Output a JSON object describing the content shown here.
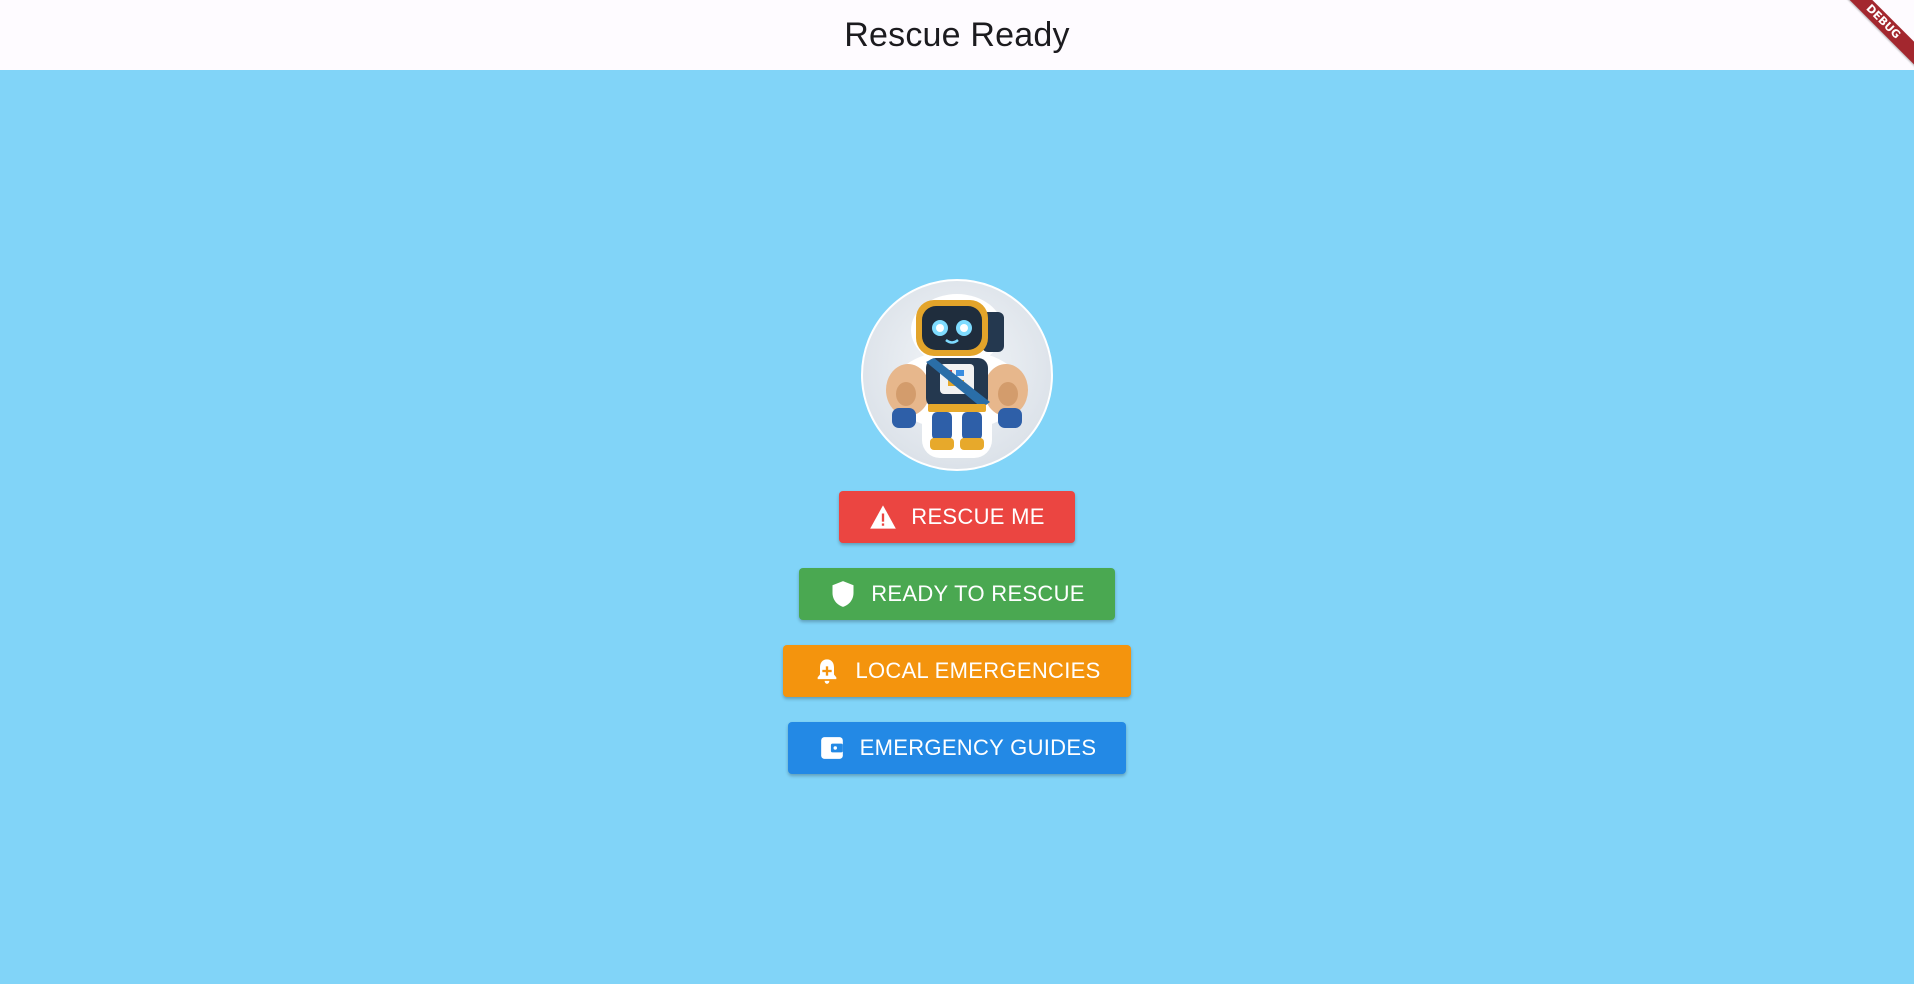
{
  "appbar": {
    "title": "Rescue Ready",
    "debug_banner": "DEBUG"
  },
  "avatar": {
    "description": "robot-mascot-image"
  },
  "buttons": [
    {
      "label": "RESCUE ME",
      "icon": "warning-icon",
      "color": "#eb4541"
    },
    {
      "label": "READY TO RESCUE",
      "icon": "shield-icon",
      "color": "#4aa851"
    },
    {
      "label": "LOCAL EMERGENCIES",
      "icon": "notification-add-icon",
      "color": "#f4940d"
    },
    {
      "label": "EMERGENCY GUIDES",
      "icon": "wallet-icon",
      "color": "#2389e5"
    }
  ],
  "colors": {
    "background": "#81d4f8",
    "appbar": "#fefbff"
  }
}
